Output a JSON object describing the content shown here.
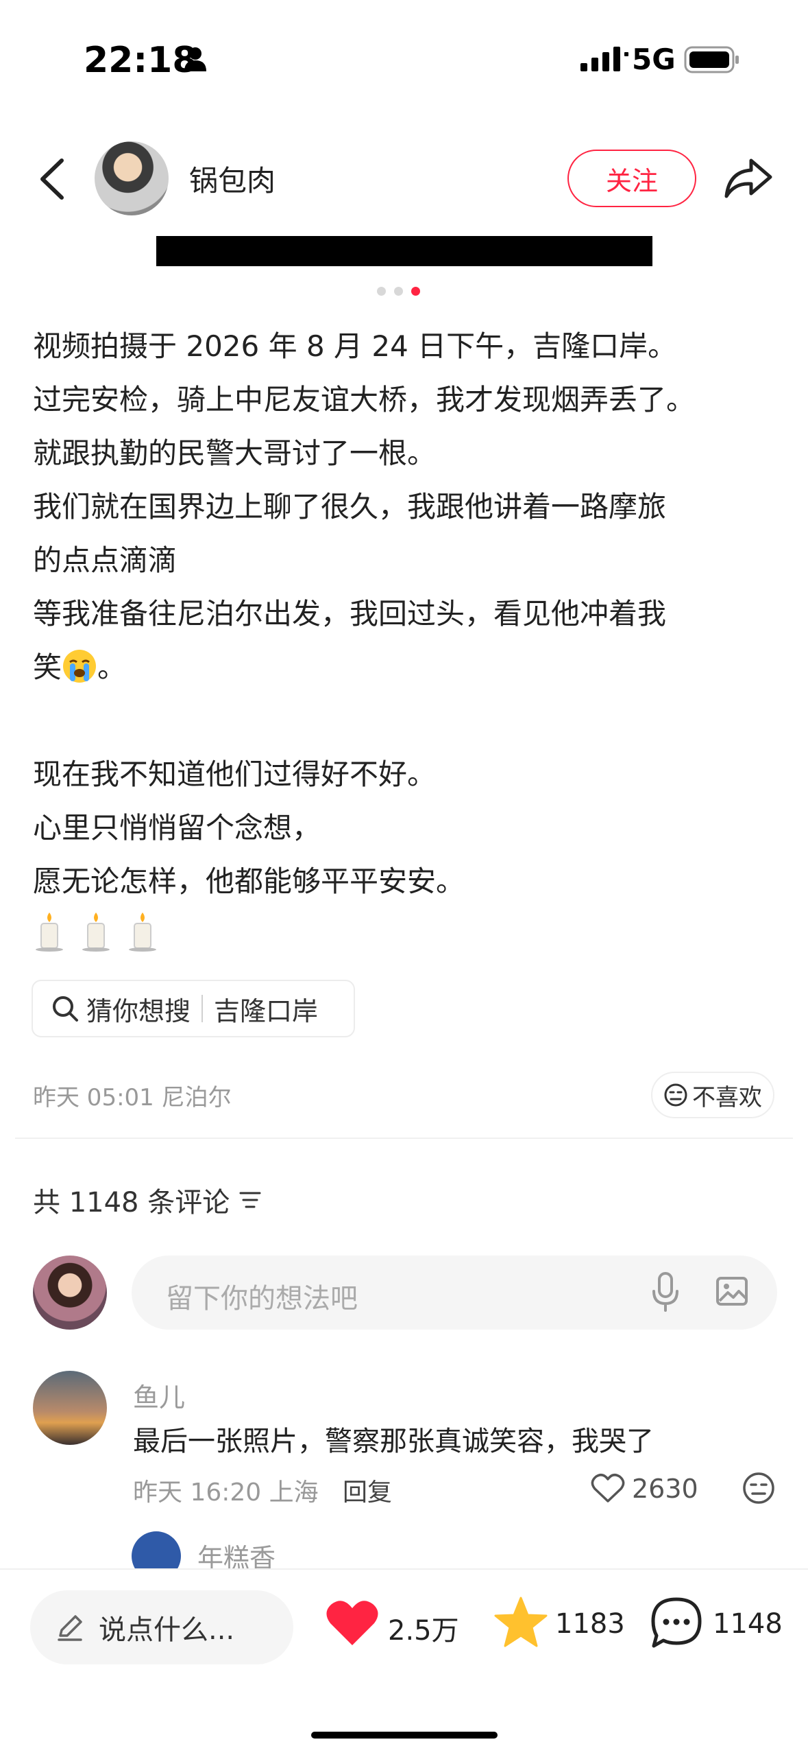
{
  "status_bar": {
    "time": "22:18",
    "network": "5G"
  },
  "header": {
    "author": "锅包肉",
    "follow_label": "关注"
  },
  "post": {
    "lines": [
      "视频拍摄于 2026 年 8 月 24 日下午，吉隆口岸。",
      "过完安检，骑上中尼友谊大桥，我才发现烟弄丢了。",
      "就跟执勤的民警大哥讨了一根。",
      "我们就在国界边上聊了很久，我跟他讲着一路摩旅",
      "的点点滴滴",
      "等我准备往尼泊尔出发，我回过头，看见他冲着我",
      "笑",
      "。",
      "现在我不知道他们过得好不好。",
      "心里只悄悄留个念想，",
      "愿无论怎样，他都能够平平安安。"
    ],
    "search_prefix": "猜你想搜",
    "search_term": "吉隆口岸",
    "meta": "昨天 05:01 尼泊尔",
    "dislike_label": "不喜欢"
  },
  "comments": {
    "count_label": "共 1148 条评论",
    "input_placeholder": "留下你的想法吧",
    "items": [
      {
        "name": "鱼儿",
        "text": "最后一张照片，警察那张真诚笑容，我哭了",
        "meta": "昨天 16:20 上海",
        "reply": "回复",
        "likes": "2630"
      },
      {
        "name": "年糕香"
      }
    ]
  },
  "bottom_bar": {
    "say_placeholder": "说点什么...",
    "likes": "2.5万",
    "favorites": "1183",
    "comments": "1148"
  },
  "colors": {
    "accent": "#ff2442",
    "star": "#ffc12e",
    "muted": "#999999"
  }
}
